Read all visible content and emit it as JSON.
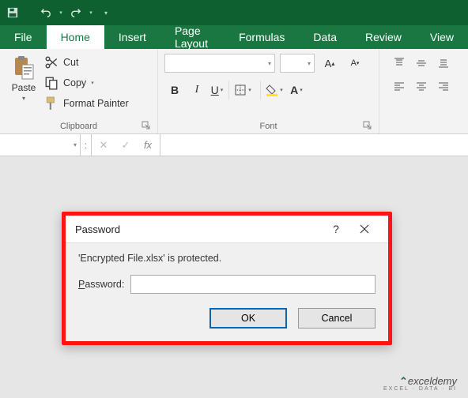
{
  "qat": {
    "save": "save-icon",
    "undo": "undo-icon",
    "redo": "redo-icon"
  },
  "tabs": {
    "file": "File",
    "home": "Home",
    "insert": "Insert",
    "pagelayout": "Page Layout",
    "formulas": "Formulas",
    "data": "Data",
    "review": "Review",
    "view": "View"
  },
  "ribbon": {
    "paste_label": "Paste",
    "clipboard": {
      "cut": "Cut",
      "copy": "Copy",
      "format_painter": "Format Painter",
      "group_label": "Clipboard"
    },
    "font": {
      "group_label": "Font",
      "font_name": "",
      "font_size": "",
      "bold": "B",
      "italic": "I",
      "underline": "U"
    }
  },
  "formula_bar": {
    "namebox": "",
    "colon": ":",
    "cancel": "✕",
    "enter": "✓",
    "fx": "fx",
    "formula": ""
  },
  "dialog": {
    "title": "Password",
    "message": "'Encrypted File.xlsx' is protected.",
    "password_label_prefix": "P",
    "password_label_rest": "assword:",
    "password_value": "",
    "ok": "OK",
    "cancel": "Cancel"
  },
  "watermark": {
    "brand": "exceldemy",
    "sub": "EXCEL · DATA · BI"
  }
}
